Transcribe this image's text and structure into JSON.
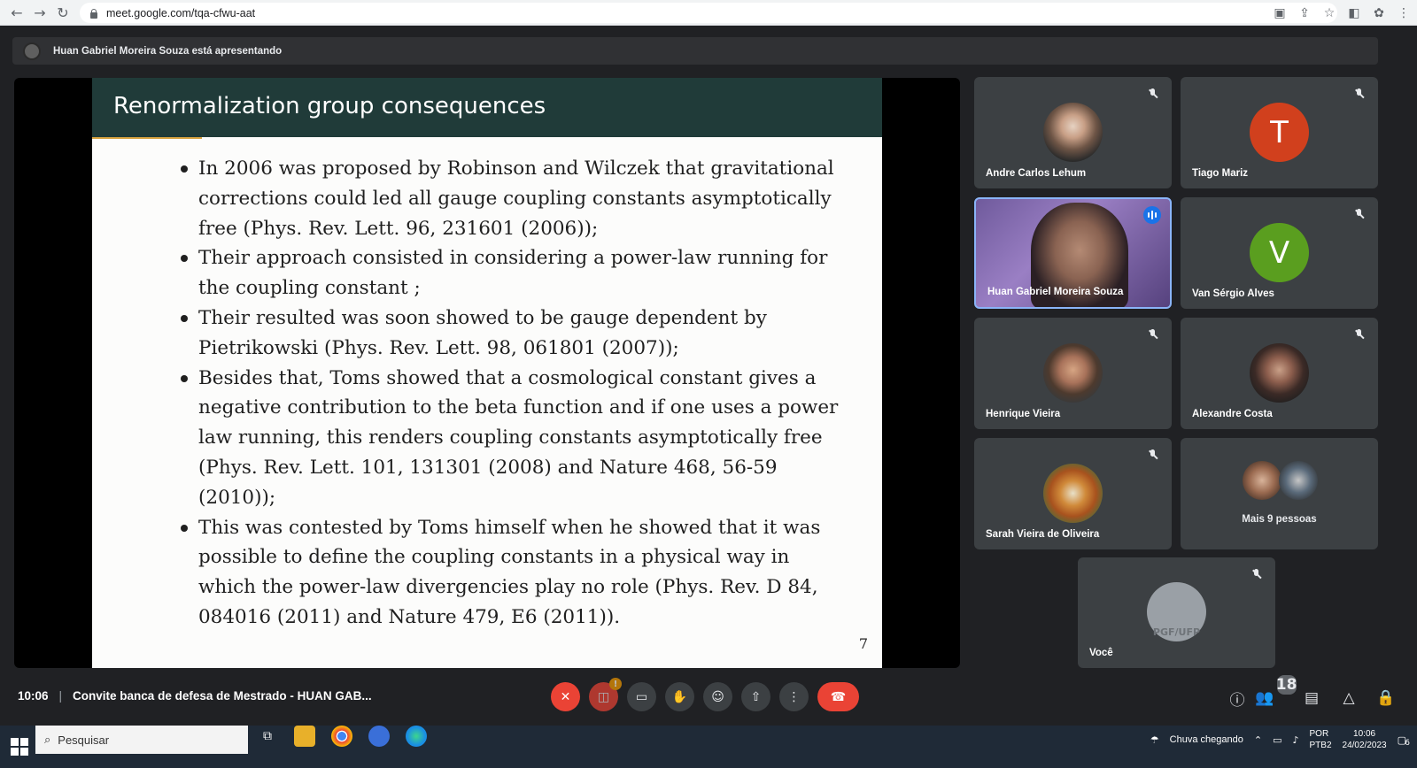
{
  "browser": {
    "url": "meet.google.com/tqa-cfwu-aat"
  },
  "banner": {
    "text": "Huan Gabriel Moreira Souza está apresentando"
  },
  "slide": {
    "title": "Renormalization group consequences",
    "bullets": [
      "In 2006 was proposed by Robinson and Wilczek that gravitational corrections could led all gauge coupling constants asymptotically free (Phys. Rev. Lett. 96, 231601 (2006));",
      "Their approach consisted in considering a power-law running for the coupling constant ;",
      "Their resulted was soon showed to be gauge dependent by Pietrikowski (Phys. Rev. Lett. 98, 061801 (2007));",
      "Besides that, Toms showed that a cosmological constant gives a negative contribution to the beta function and if one uses a power law running, this renders coupling constants asymptotically free (Phys. Rev. Lett. 101, 131301 (2008) and Nature 468, 56-59 (2010));",
      "This was contested by Toms himself when he showed that it was possible to define the coupling constants in a physical way in which the power-law divergencies play no role (Phys. Rev. D 84, 084016 (2011) and Nature 479, E6 (2011))."
    ],
    "page_number": "7"
  },
  "participants": [
    {
      "name": "Andre Carlos Lehum"
    },
    {
      "name": "Tiago Mariz",
      "initial": "T",
      "color": "#d1401d"
    },
    {
      "name": "Huan Gabriel Moreira Souza"
    },
    {
      "name": "Van Sérgio Alves",
      "initial": "V",
      "color": "#5a9e1f"
    },
    {
      "name": "Henrique Vieira"
    },
    {
      "name": "Alexandre Costa"
    },
    {
      "name": "Sarah Vieira de Oliveira"
    },
    {
      "name": "Mais 9 pessoas"
    },
    {
      "name": "Você",
      "logo_text": "PGF/UFP"
    }
  ],
  "bottom": {
    "time": "10:06",
    "meeting_title": "Convite banca de defesa de Mestrado - HUAN GAB...",
    "warning_badge": "!",
    "people_count": "18"
  },
  "taskbar": {
    "search_placeholder": "Pesquisar",
    "weather": "Chuva chegando",
    "lang_top": "POR",
    "lang_bottom": "PTB2",
    "clock_time": "10:06",
    "clock_date": "24/02/2023",
    "notification_count": "6"
  }
}
